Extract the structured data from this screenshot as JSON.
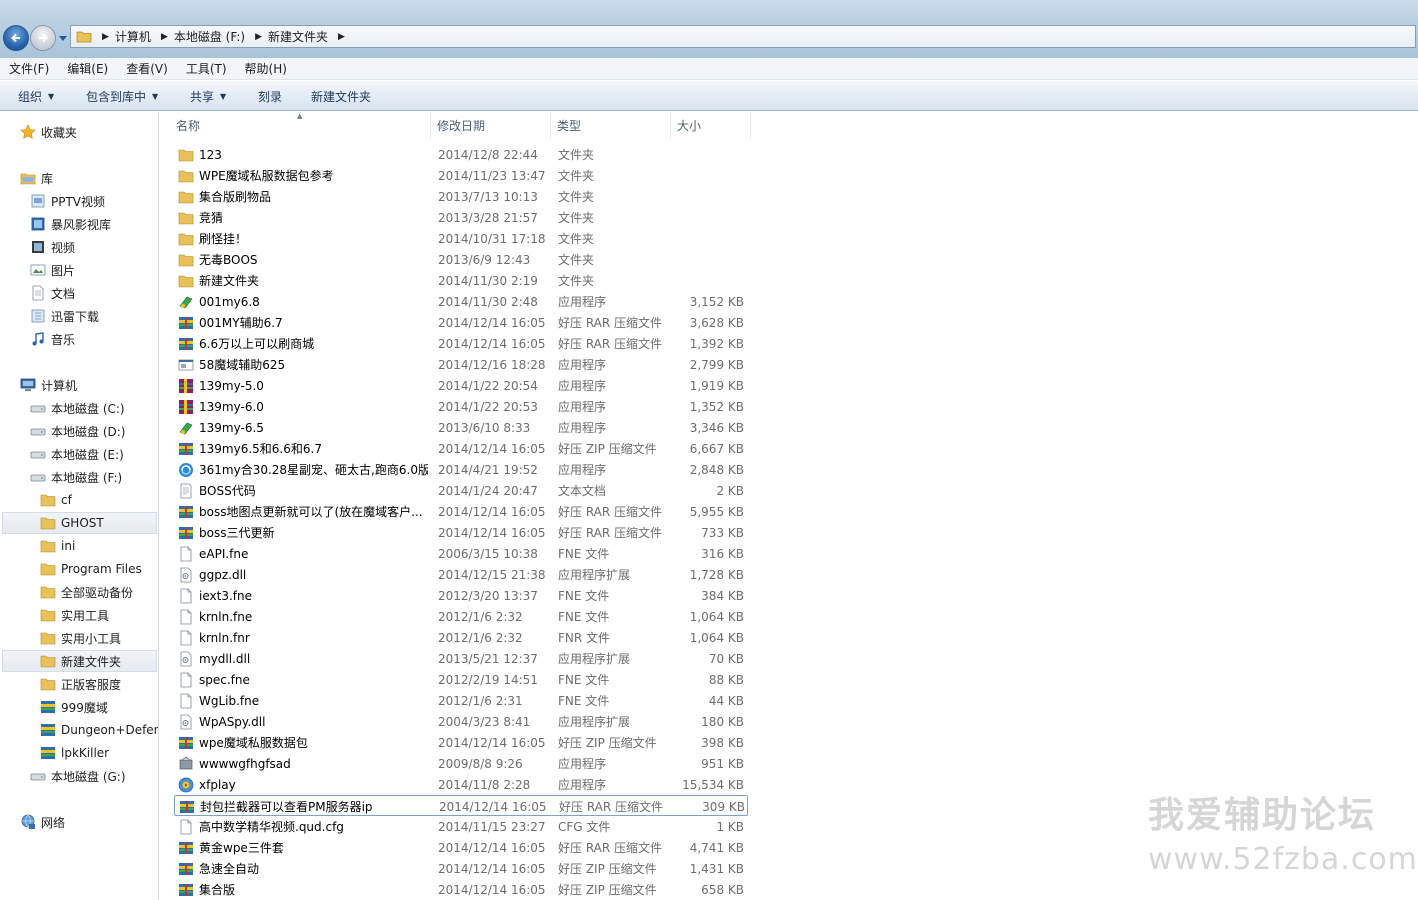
{
  "address": {
    "crumbs": [
      "计算机",
      "本地磁盘 (F:)",
      "新建文件夹"
    ]
  },
  "menu": [
    "文件(F)",
    "编辑(E)",
    "查看(V)",
    "工具(T)",
    "帮助(H)"
  ],
  "toolbar": {
    "organize": "组织",
    "include_library": "包含到库中",
    "share": "共享",
    "burn": "刻录",
    "new_folder": "新建文件夹"
  },
  "nav": {
    "favorites": "收藏夹",
    "libraries": "库",
    "library_items": [
      "PPTV视频",
      "暴风影视库",
      "视频",
      "图片",
      "文档",
      "迅雷下载",
      "音乐"
    ],
    "computer": "计算机",
    "drives": [
      "本地磁盘 (C:)",
      "本地磁盘 (D:)",
      "本地磁盘 (E:)",
      "本地磁盘 (F:)"
    ],
    "f_children": [
      "cf",
      "GHOST",
      "ini",
      "Program Files",
      "全部驱动备份",
      "实用工具",
      "实用小工具",
      "新建文件夹",
      "正版客服度",
      "999魔域",
      "Dungeon+Defen",
      "lpkKiller"
    ],
    "drive_g": "本地磁盘 (G:)",
    "network": "网络"
  },
  "columns": {
    "name": "名称",
    "date": "修改日期",
    "type": "类型",
    "size": "大小"
  },
  "files": [
    {
      "name": "123",
      "date": "2014/12/8 22:44",
      "type": "文件夹",
      "size": "",
      "icon": "folder"
    },
    {
      "name": "WPE魔域私服数据包参考",
      "date": "2014/11/23 13:47",
      "type": "文件夹",
      "size": "",
      "icon": "folder"
    },
    {
      "name": "集合版刷物品",
      "date": "2013/7/13 10:13",
      "type": "文件夹",
      "size": "",
      "icon": "folder"
    },
    {
      "name": "竞猜",
      "date": "2013/3/28 21:57",
      "type": "文件夹",
      "size": "",
      "icon": "folder"
    },
    {
      "name": "刷怪挂！",
      "date": "2014/10/31 17:18",
      "type": "文件夹",
      "size": "",
      "icon": "folder"
    },
    {
      "name": "无毒BOOS",
      "date": "2013/6/9 12:43",
      "type": "文件夹",
      "size": "",
      "icon": "folder"
    },
    {
      "name": "新建文件夹",
      "date": "2014/11/30 2:19",
      "type": "文件夹",
      "size": "",
      "icon": "folder"
    },
    {
      "name": "001my6.8",
      "date": "2014/11/30 2:48",
      "type": "应用程序",
      "size": "3,152 KB",
      "icon": "app-green"
    },
    {
      "name": "001MY辅助6.7",
      "date": "2014/12/14 16:05",
      "type": "好压 RAR 压缩文件",
      "size": "3,628 KB",
      "icon": "archive"
    },
    {
      "name": "6.6万以上可以刷商城",
      "date": "2014/12/14 16:05",
      "type": "好压 RAR 压缩文件",
      "size": "1,392 KB",
      "icon": "archive"
    },
    {
      "name": "58魔域辅助625",
      "date": "2014/12/16 18:28",
      "type": "应用程序",
      "size": "2,799 KB",
      "icon": "app-window"
    },
    {
      "name": "139my-5.0",
      "date": "2014/1/22 20:54",
      "type": "应用程序",
      "size": "1,919 KB",
      "icon": "app-winrar"
    },
    {
      "name": "139my-6.0",
      "date": "2014/1/22 20:53",
      "type": "应用程序",
      "size": "1,352 KB",
      "icon": "app-winrar"
    },
    {
      "name": "139my-6.5",
      "date": "2013/6/10 8:33",
      "type": "应用程序",
      "size": "3,346 KB",
      "icon": "app-green"
    },
    {
      "name": "139my6.5和6.6和6.7",
      "date": "2014/12/14 16:05",
      "type": "好压 ZIP 压缩文件",
      "size": "6,667 KB",
      "icon": "archive"
    },
    {
      "name": "361my合30.28星副宠、砸太古,跑商6.0版",
      "date": "2014/4/21 19:52",
      "type": "应用程序",
      "size": "2,848 KB",
      "icon": "app-blue"
    },
    {
      "name": "BOSS代码",
      "date": "2014/1/24 20:47",
      "type": "文本文档",
      "size": "2 KB",
      "icon": "text"
    },
    {
      "name": "boss地图点更新就可以了(放在魔域客户...",
      "date": "2014/12/14 16:05",
      "type": "好压 RAR 压缩文件",
      "size": "5,955 KB",
      "icon": "archive"
    },
    {
      "name": "boss三代更新",
      "date": "2014/12/14 16:05",
      "type": "好压 RAR 压缩文件",
      "size": "733 KB",
      "icon": "archive"
    },
    {
      "name": "eAPI.fne",
      "date": "2006/3/15 10:38",
      "type": "FNE 文件",
      "size": "316 KB",
      "icon": "file"
    },
    {
      "name": "ggpz.dll",
      "date": "2014/12/15 21:38",
      "type": "应用程序扩展",
      "size": "1,728 KB",
      "icon": "dll"
    },
    {
      "name": "iext3.fne",
      "date": "2012/3/20 13:37",
      "type": "FNE 文件",
      "size": "384 KB",
      "icon": "file"
    },
    {
      "name": "krnln.fne",
      "date": "2012/1/6 2:32",
      "type": "FNE 文件",
      "size": "1,064 KB",
      "icon": "file"
    },
    {
      "name": "krnln.fnr",
      "date": "2012/1/6 2:32",
      "type": "FNR 文件",
      "size": "1,064 KB",
      "icon": "file"
    },
    {
      "name": "mydll.dll",
      "date": "2013/5/21 12:37",
      "type": "应用程序扩展",
      "size": "70 KB",
      "icon": "dll"
    },
    {
      "name": "spec.fne",
      "date": "2012/2/19 14:51",
      "type": "FNE 文件",
      "size": "88 KB",
      "icon": "file"
    },
    {
      "name": "WgLib.fne",
      "date": "2012/1/6 2:31",
      "type": "FNE 文件",
      "size": "44 KB",
      "icon": "file"
    },
    {
      "name": "WpASpy.dll",
      "date": "2004/3/23 8:41",
      "type": "应用程序扩展",
      "size": "180 KB",
      "icon": "dll"
    },
    {
      "name": "wpe魔域私服数据包",
      "date": "2014/12/14 16:05",
      "type": "好压 ZIP 压缩文件",
      "size": "398 KB",
      "icon": "archive"
    },
    {
      "name": "wwwwgfhgfsad",
      "date": "2009/8/8 9:26",
      "type": "应用程序",
      "size": "951 KB",
      "icon": "app-gray"
    },
    {
      "name": "xfplay",
      "date": "2014/11/8 2:28",
      "type": "应用程序",
      "size": "15,534 KB",
      "icon": "app-play"
    },
    {
      "name": "封包拦截器可以查看PM服务器ip",
      "date": "2014/12/14 16:05",
      "type": "好压 RAR 压缩文件",
      "size": "309 KB",
      "icon": "archive"
    },
    {
      "name": "高中数学精华视频.qud.cfg",
      "date": "2014/11/15 23:27",
      "type": "CFG 文件",
      "size": "1 KB",
      "icon": "file"
    },
    {
      "name": "黄金wpe三件套",
      "date": "2014/12/14 16:05",
      "type": "好压 RAR 压缩文件",
      "size": "4,741 KB",
      "icon": "archive"
    },
    {
      "name": "急速全自动",
      "date": "2014/12/14 16:05",
      "type": "好压 ZIP 压缩文件",
      "size": "1,431 KB",
      "icon": "archive"
    },
    {
      "name": "集合版",
      "date": "2014/12/14 16:05",
      "type": "好压 ZIP 压缩文件",
      "size": "658 KB",
      "icon": "archive"
    }
  ],
  "watermark": {
    "line1": "我爱辅助论坛",
    "line2": "www.52fzba.com"
  }
}
